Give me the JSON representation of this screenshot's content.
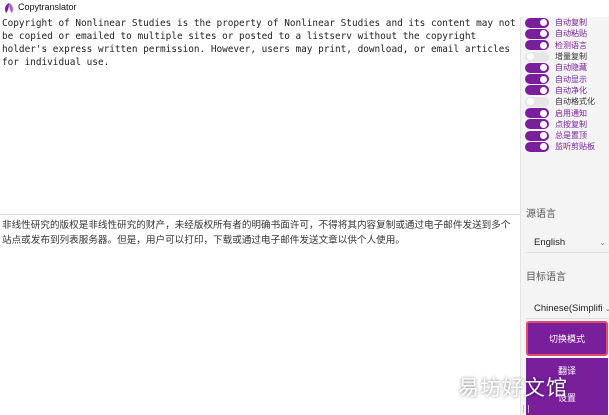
{
  "window": {
    "title": "Copytranslator",
    "icon": "copytranslator-logo-icon",
    "accent": "#7a1f9c"
  },
  "source": {
    "text": "Copyright of Nonlinear Studies is the property of Nonlinear Studies and its content may not be copied or emailed to multiple sites or posted to a listserv without the copyright holder's express written permission. However, users may print, download, or email articles for individual use."
  },
  "target": {
    "text": "非线性研究的版权是非线性研究的财产，未经版权所有者的明确书面许可，不得将其内容复制或通过电子邮件发送到多个站点或发布到列表服务器。但是，用户可以打印，下载或通过电子邮件发送文章以供个人使用。"
  },
  "options": [
    {
      "label": "自动复制",
      "on": true
    },
    {
      "label": "自动粘贴",
      "on": true
    },
    {
      "label": "检测语言",
      "on": true
    },
    {
      "label": "增量复制",
      "on": false
    },
    {
      "label": "自动隐藏",
      "on": true
    },
    {
      "label": "自动显示",
      "on": true
    },
    {
      "label": "自动净化",
      "on": true
    },
    {
      "label": "自动格式化",
      "on": false
    },
    {
      "label": "启用通知",
      "on": true
    },
    {
      "label": "点按复制",
      "on": true
    },
    {
      "label": "总是置顶",
      "on": true
    },
    {
      "label": "监听剪贴板",
      "on": true
    }
  ],
  "source_lang": {
    "label": "源语言",
    "value": "English"
  },
  "target_lang": {
    "label": "目标语言",
    "value": "Chinese(Simplifi"
  },
  "buttons": {
    "switch_mode": "切换模式",
    "translate": "翻译",
    "settings": "设置"
  },
  "watermark": "易坊好文馆"
}
